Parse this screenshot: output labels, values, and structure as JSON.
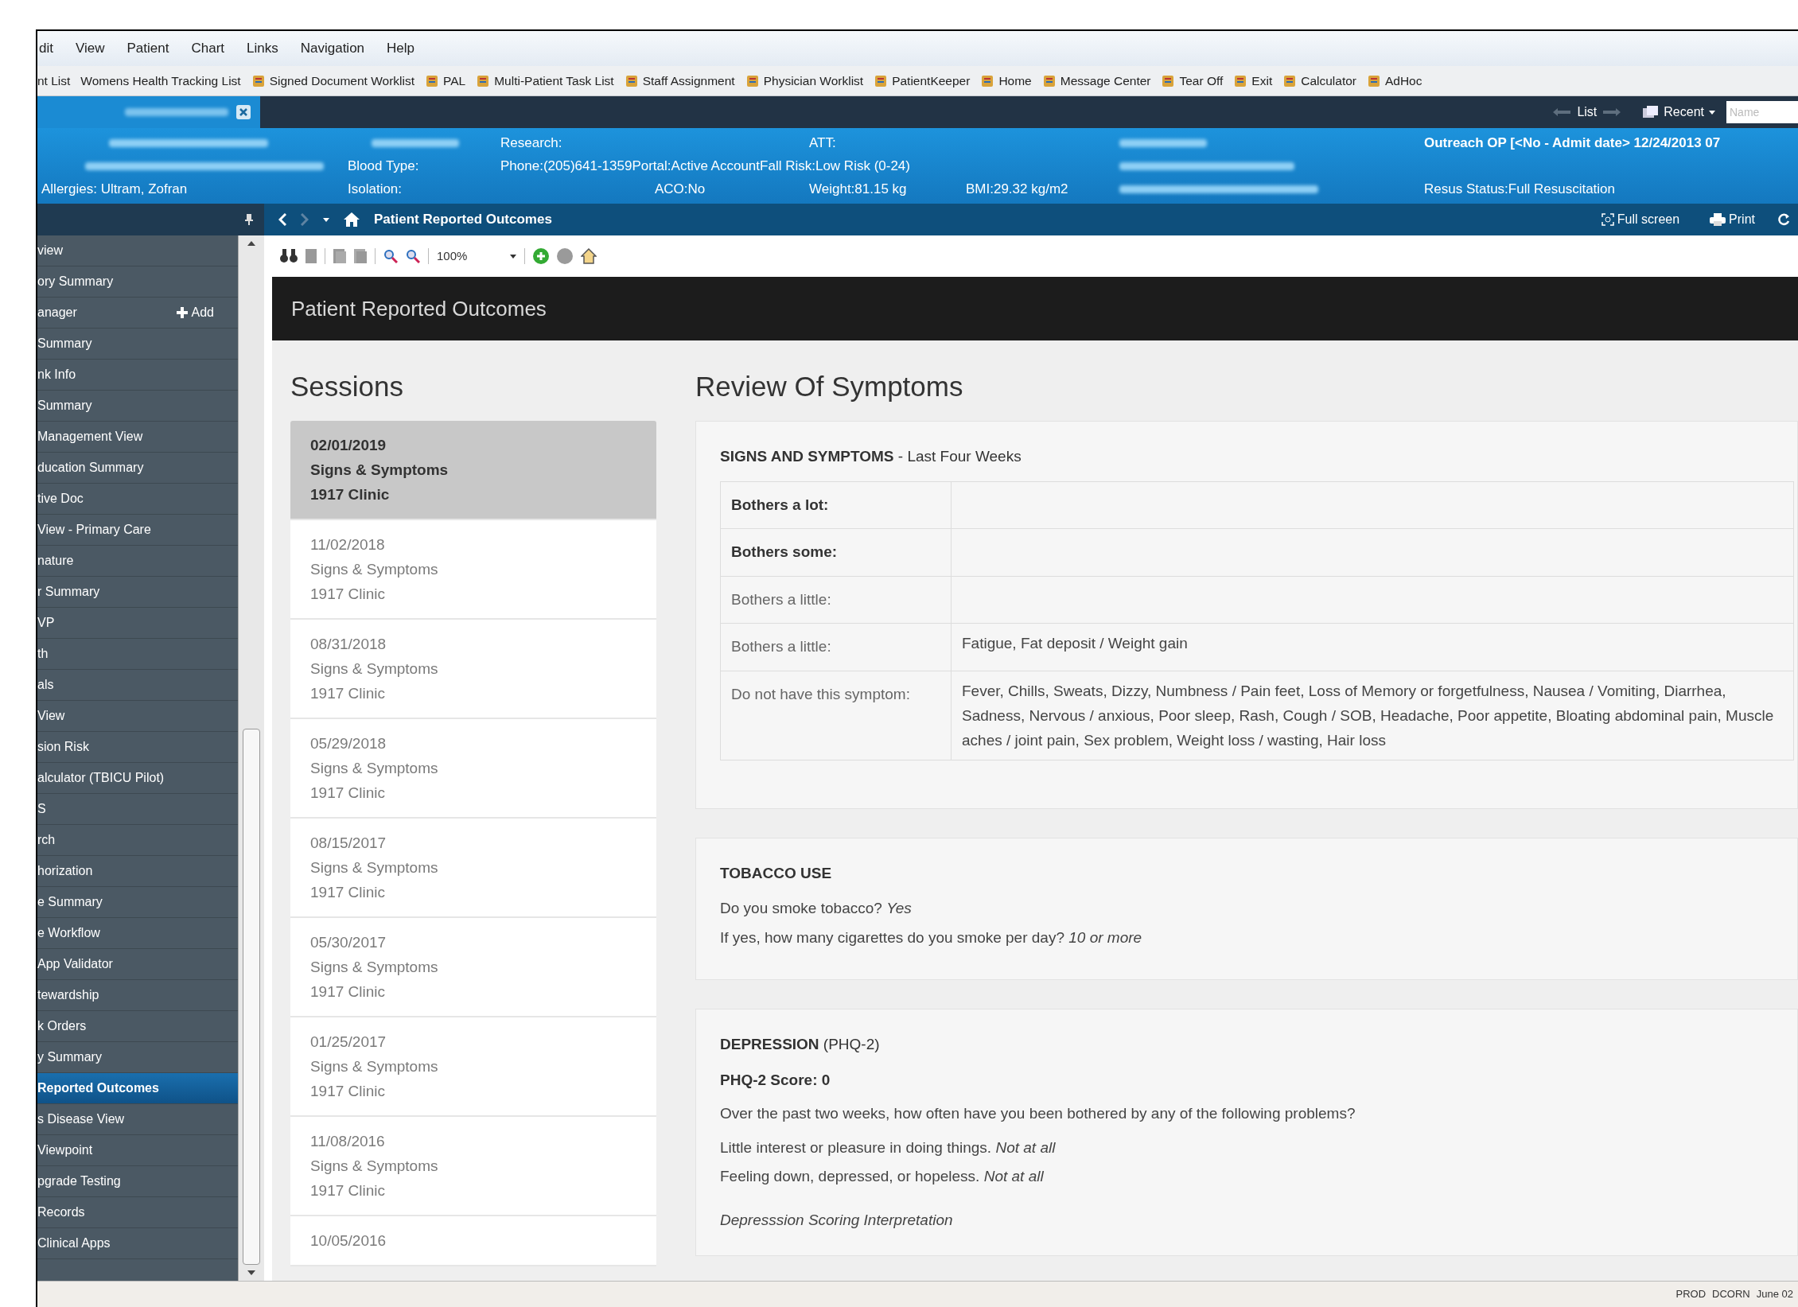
{
  "menu": [
    "dit",
    "View",
    "Patient",
    "Chart",
    "Links",
    "Navigation",
    "Help"
  ],
  "toolbar": [
    {
      "label": "nt List",
      "has_icon": false
    },
    {
      "label": "Womens Health Tracking List",
      "has_icon": false
    },
    {
      "label": "Signed Document Worklist",
      "has_icon": true
    },
    {
      "label": "PAL",
      "has_icon": true
    },
    {
      "label": "Multi-Patient Task List",
      "has_icon": true
    },
    {
      "label": "Staff Assignment",
      "has_icon": true
    },
    {
      "label": "Physician Worklist",
      "has_icon": true
    },
    {
      "label": "PatientKeeper",
      "has_icon": true
    },
    {
      "label": "Home",
      "has_icon": true
    },
    {
      "label": "Message Center",
      "has_icon": true
    },
    {
      "label": "Tear Off",
      "has_icon": true
    },
    {
      "label": "Exit",
      "has_icon": true
    },
    {
      "label": "Calculator",
      "has_icon": true
    },
    {
      "label": "AdHoc",
      "has_icon": true
    }
  ],
  "tab_strip": {
    "list": "List",
    "recent": "Recent",
    "search_placeholder": "Name"
  },
  "banner": {
    "research": "Research:",
    "att": "ATT:",
    "encounter": "Outreach OP [<No - Admit date> 12/24/2013 07",
    "blood_type": "Blood Type:",
    "contact": "Phone:(205)641-1359Portal:Active AccountFall Risk:Low Risk (0-24)",
    "allergies": "Allergies: Ultram, Zofran",
    "isolation": "Isolation:",
    "aco": "ACO:No",
    "weight": "Weight:81.15 kg",
    "bmi": "BMI:29.32 kg/m2",
    "resus": "Resus Status:Full Resuscitation"
  },
  "nav": {
    "title": "Patient Reported Outcomes",
    "full_screen": "Full screen",
    "print": "Print"
  },
  "sidebar": {
    "add": "Add",
    "items": [
      {
        "label": "view",
        "selected": false
      },
      {
        "label": "ory Summary",
        "selected": false
      },
      {
        "label": "anager",
        "selected": false
      },
      {
        "label": "Summary",
        "selected": false
      },
      {
        "label": "nk Info",
        "selected": false
      },
      {
        "label": "Summary",
        "selected": false
      },
      {
        "label": "Management View",
        "selected": false
      },
      {
        "label": "ducation Summary",
        "selected": false
      },
      {
        "label": "tive Doc",
        "selected": false
      },
      {
        "label": "View - Primary Care",
        "selected": false
      },
      {
        "label": "nature",
        "selected": false
      },
      {
        "label": "r Summary",
        "selected": false
      },
      {
        "label": "VP",
        "selected": false
      },
      {
        "label": "th",
        "selected": false
      },
      {
        "label": "als",
        "selected": false
      },
      {
        "label": "View",
        "selected": false
      },
      {
        "label": "sion Risk",
        "selected": false
      },
      {
        "label": "alculator (TBICU Pilot)",
        "selected": false
      },
      {
        "label": "S",
        "selected": false
      },
      {
        "label": "rch",
        "selected": false
      },
      {
        "label": "horization",
        "selected": false
      },
      {
        "label": "e Summary",
        "selected": false
      },
      {
        "label": "e Workflow",
        "selected": false
      },
      {
        "label": "App Validator",
        "selected": false
      },
      {
        "label": "tewardship",
        "selected": false
      },
      {
        "label": "k Orders",
        "selected": false
      },
      {
        "label": "y Summary",
        "selected": false
      },
      {
        "label": "Reported Outcomes",
        "selected": true
      },
      {
        "label": "s Disease View",
        "selected": false
      },
      {
        "label": "Viewpoint",
        "selected": false
      },
      {
        "label": "pgrade Testing",
        "selected": false
      },
      {
        "label": "Records",
        "selected": false
      },
      {
        "label": "Clinical Apps",
        "selected": false
      }
    ]
  },
  "viewer": {
    "zoom": "100%"
  },
  "page_header": "Patient Reported Outcomes",
  "sessions": {
    "title": "Sessions",
    "items": [
      {
        "date": "02/01/2019",
        "type": "Signs & Symptoms",
        "clinic": "1917 Clinic",
        "selected": true
      },
      {
        "date": "11/02/2018",
        "type": "Signs & Symptoms",
        "clinic": "1917 Clinic",
        "selected": false
      },
      {
        "date": "08/31/2018",
        "type": "Signs & Symptoms",
        "clinic": "1917 Clinic",
        "selected": false
      },
      {
        "date": "05/29/2018",
        "type": "Signs & Symptoms",
        "clinic": "1917 Clinic",
        "selected": false
      },
      {
        "date": "08/15/2017",
        "type": "Signs & Symptoms",
        "clinic": "1917 Clinic",
        "selected": false
      },
      {
        "date": "05/30/2017",
        "type": "Signs & Symptoms",
        "clinic": "1917 Clinic",
        "selected": false
      },
      {
        "date": "01/25/2017",
        "type": "Signs & Symptoms",
        "clinic": "1917 Clinic",
        "selected": false
      },
      {
        "date": "11/08/2016",
        "type": "Signs & Symptoms",
        "clinic": "1917 Clinic",
        "selected": false
      },
      {
        "date": "10/05/2016",
        "selected": false
      }
    ]
  },
  "review": {
    "title": "Review Of Symptoms",
    "sections": [
      {
        "heading": "**SIGNS AND SYMPTOMS** - Last Four Weeks",
        "table": [
          {
            "label": "Bothers a lot:",
            "emphasized": true
          },
          {
            "label": "Bothers some:",
            "emphasized": true
          },
          {
            "label": "Bothers a little:",
            "emphasized": false
          },
          {
            "label": "Bothers a little:",
            "value": "Fatigue, Fat deposit / Weight gain",
            "emphasized": false
          },
          {
            "label": "Do not have this symptom:",
            "value": "Fever, Chills, Sweats, Dizzy, Numbness / Pain feet, Loss of Memory or forgetfulness, Nausea / Vomiting, Diarrhea, Sadness, Nervous / anxious, Poor sleep, Rash, Cough / SOB, Headache, Poor appetite, Bloating abdominal pain, Muscle aches / joint pain, Sex problem, Weight loss / wasting, Hair loss",
            "emphasized": false
          }
        ]
      },
      {
        "heading": "**TOBACCO USE**",
        "lines": [
          {
            "kind": "answer",
            "text": "Do you smoke tobacco? *Yes*"
          },
          {
            "kind": "answer",
            "text": "If yes, how many cigarettes do you smoke per day? *10 or more*"
          }
        ]
      },
      {
        "heading": "**DEPRESSION** (PHQ-2)",
        "lines": [
          {
            "kind": "score",
            "text": "PHQ-2 Score: 0"
          },
          {
            "kind": "question",
            "text": "Over the past two weeks, how often have you been bothered by any of the following problems?"
          },
          {
            "kind": "answer",
            "text": "Little interest or pleasure in doing things. *Not at all*"
          },
          {
            "kind": "answer",
            "text": "Feeling down, depressed, or hopeless. *Not at all*"
          },
          {
            "kind": "note",
            "text": "Depresssion Scoring Interpretation"
          }
        ]
      }
    ]
  },
  "status_bar": [
    "PROD",
    "DCORN",
    "June 02"
  ]
}
